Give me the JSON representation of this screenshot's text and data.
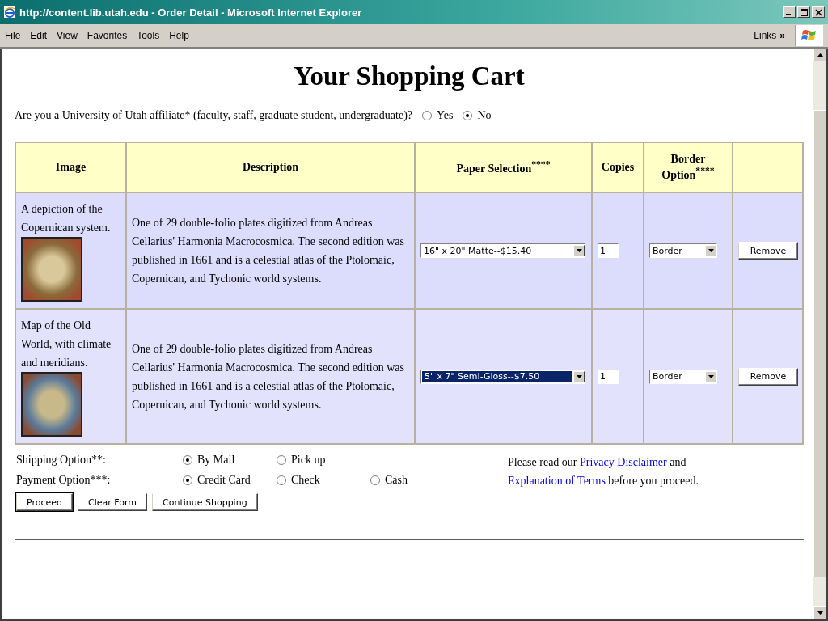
{
  "window": {
    "title": "http://content.lib.utah.edu - Order Detail - Microsoft Internet Explorer"
  },
  "menu": [
    "File",
    "Edit",
    "View",
    "Favorites",
    "Tools",
    "Help"
  ],
  "links_label": "Links",
  "links_chevron": "»",
  "heading": "Your Shopping Cart",
  "affiliate": {
    "question": "Are you a University of Utah affiliate* (faculty, staff, graduate student, undergraduate)?",
    "options": [
      {
        "label": "Yes",
        "selected": false
      },
      {
        "label": "No",
        "selected": true
      }
    ]
  },
  "table": {
    "columns": [
      "Image",
      "Description",
      "Paper Selection$^{****}$",
      "Copies",
      "Border Option$^{****}$"
    ],
    "rows": [
      {
        "image_caption": "A depiction of the Copernican system.",
        "description": "One of 29 double-folio plates digitized from Andreas Cellarius' Harmonia Macrocosmica. The second edition was published in 1661 and is a celestial atlas of the Ptolomaic, Copernican, and Tychonic world systems.",
        "paper": "16\" x 20\" Matte--$15.40",
        "paper_focused": false,
        "copies": "1",
        "border": "Border",
        "remove": "Remove"
      },
      {
        "image_caption": "Map of the Old World, with climate and meridians.",
        "description": "One of 29 double-folio plates digitized from Andreas Cellarius' Harmonia Macrocosmica. The second edition was published in 1661 and is a celestial atlas of the Ptolomaic, Copernican, and Tychonic world systems.",
        "paper": "5\" x 7\" Semi-Gloss--$7.50",
        "paper_focused": true,
        "copies": "1",
        "border": "Border",
        "remove": "Remove"
      }
    ]
  },
  "shipping": {
    "label": "Shipping Option**:",
    "options": [
      {
        "label": "By Mail",
        "selected": true
      },
      {
        "label": "Pick up",
        "selected": false
      }
    ]
  },
  "payment": {
    "label": "Payment Option***:",
    "options": [
      {
        "label": "Credit Card",
        "selected": true
      },
      {
        "label": "Check",
        "selected": false
      },
      {
        "label": "Cash",
        "selected": false
      }
    ]
  },
  "notice": {
    "before": "Please read our",
    "link1": "Privacy Disclaimer",
    "middle": "and",
    "link2": "Explanation of Terms",
    "after": "before you proceed."
  },
  "buttons": [
    "Proceed",
    "Clear Form",
    "Continue Shopping"
  ]
}
